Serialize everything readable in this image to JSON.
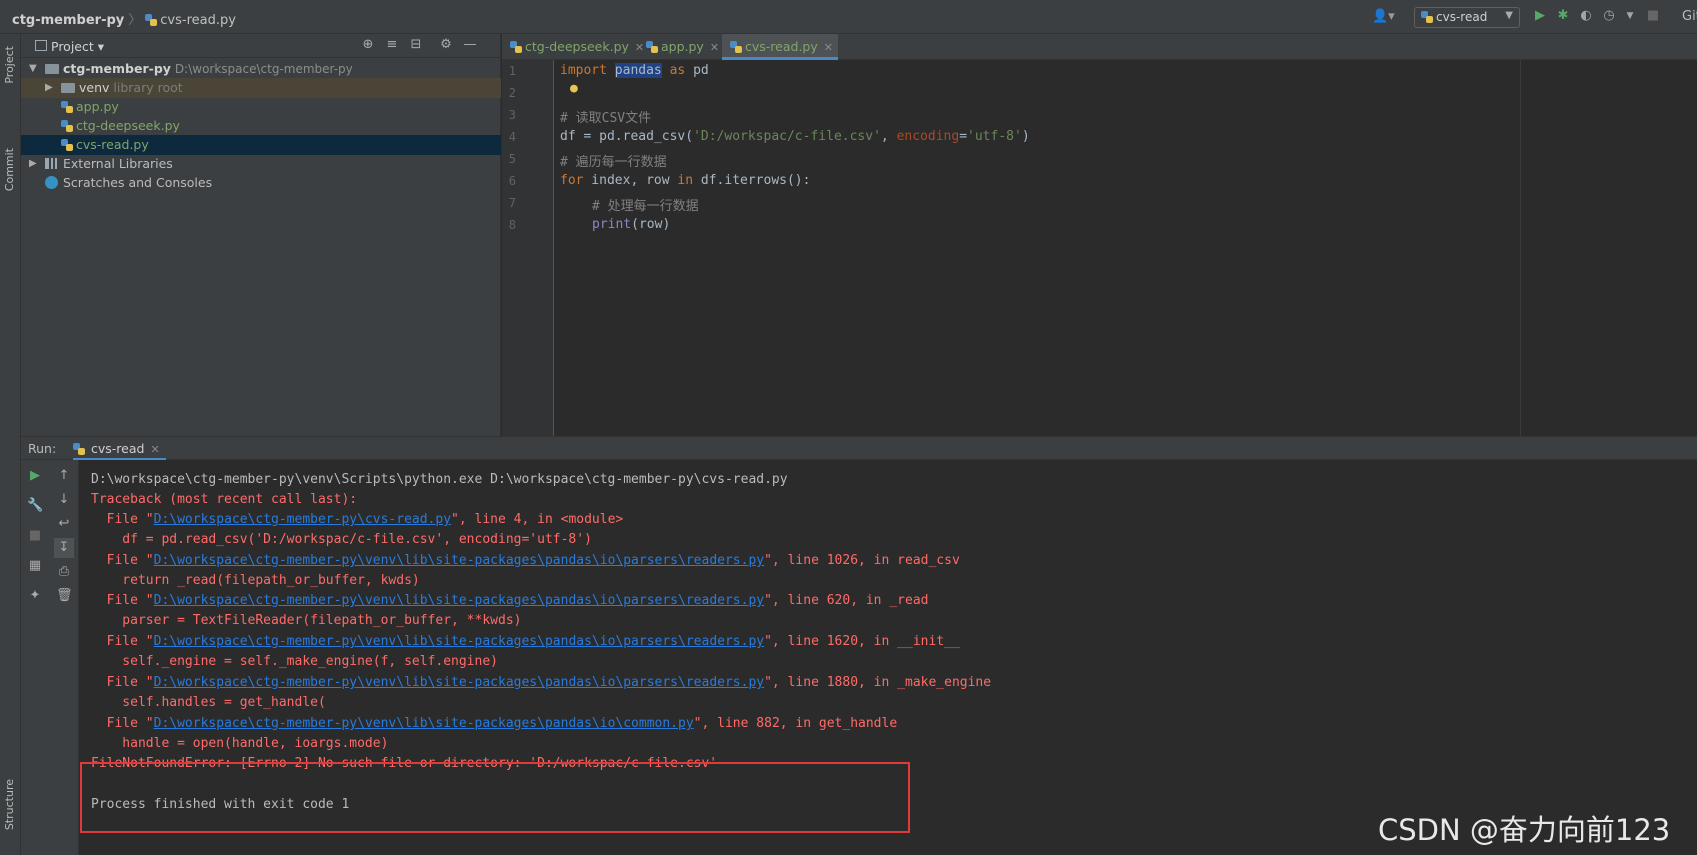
{
  "breadcrumb": {
    "project": "ctg-member-py",
    "file": "cvs-read.py"
  },
  "toolbar": {
    "run_config": "cvs-read",
    "git": "Git:"
  },
  "side_tabs": {
    "project": "Project",
    "commit": "Commit",
    "structure": "Structure"
  },
  "project_panel": {
    "title": "Project",
    "root_name": "ctg-member-py",
    "root_path": "D:\\workspace\\ctg-member-py",
    "venv_name": "venv",
    "venv_hint": "library root",
    "files": [
      "app.py",
      "ctg-deepseek.py",
      "cvs-read.py"
    ],
    "external_libraries": "External Libraries",
    "scratches": "Scratches and Consoles"
  },
  "editor_tabs": [
    "ctg-deepseek.py",
    "app.py",
    "cvs-read.py"
  ],
  "code": {
    "line_numbers": [
      "1",
      "2",
      "3",
      "4",
      "5",
      "6",
      "7",
      "8"
    ],
    "l1_kw": "import",
    "l1_mod": "pandas",
    "l1_as": "as",
    "l1_alias": "pd",
    "l3": "# 读取CSV文件",
    "l4_a": "df = pd.read_csv(",
    "l4_str": "'D:/workspac/c-file.csv'",
    "l4_b": ", ",
    "l4_param": "encoding",
    "l4_eq": "=",
    "l4_str2": "'utf-8'",
    "l4_c": ")",
    "l5": "# 遍历每一行数据",
    "l6_for": "for",
    "l6_a": " index, row ",
    "l6_in": "in",
    "l6_b": " df.iterrows():",
    "l7": "# 处理每一行数据",
    "l8_fn": "print",
    "l8_rest": "(row)"
  },
  "run_panel": {
    "label": "Run:",
    "tab": "cvs-read"
  },
  "console": {
    "cmd": "D:\\workspace\\ctg-member-py\\venv\\Scripts\\python.exe D:\\workspace\\ctg-member-py\\cvs-read.py",
    "traceback": "Traceback (most recent call last):",
    "f1_pre": "  File \"",
    "f1_link": "D:\\workspace\\ctg-member-py\\cvs-read.py",
    "f1_post": "\", line 4, in <module>",
    "f1_code": "    df = pd.read_csv('D:/workspac/c-file.csv', encoding='utf-8')",
    "f2_link": "D:\\workspace\\ctg-member-py\\venv\\lib\\site-packages\\pandas\\io\\parsers\\readers.py",
    "f2_post": "\", line 1026, in read_csv",
    "f2_code": "    return _read(filepath_or_buffer, kwds)",
    "f3_link": "D:\\workspace\\ctg-member-py\\venv\\lib\\site-packages\\pandas\\io\\parsers\\readers.py",
    "f3_post": "\", line 620, in _read",
    "f3_code": "    parser = TextFileReader(filepath_or_buffer, **kwds)",
    "f4_link": "D:\\workspace\\ctg-member-py\\venv\\lib\\site-packages\\pandas\\io\\parsers\\readers.py",
    "f4_post": "\", line 1620, in __init__",
    "f4_code": "    self._engine = self._make_engine(f, self.engine)",
    "f5_link": "D:\\workspace\\ctg-member-py\\venv\\lib\\site-packages\\pandas\\io\\parsers\\readers.py",
    "f5_post": "\", line 1880, in _make_engine",
    "f5_code": "    self.handles = get_handle(",
    "f6_link": "D:\\workspace\\ctg-member-py\\venv\\lib\\site-packages\\pandas\\io\\common.py",
    "f6_post": "\", line 882, in get_handle",
    "f6_code": "    handle = open(handle, ioargs.mode)",
    "error": "FileNotFoundError: [Errno 2] No such file or directory: 'D:/workspac/c-file.csv'",
    "exit": "Process finished with exit code 1"
  },
  "watermark": "CSDN @奋力向前123",
  "colors": {
    "accent": "#4a88c7",
    "error": "#ff6b68",
    "link": "#287bde",
    "highlight_box": "#e03a3a"
  }
}
